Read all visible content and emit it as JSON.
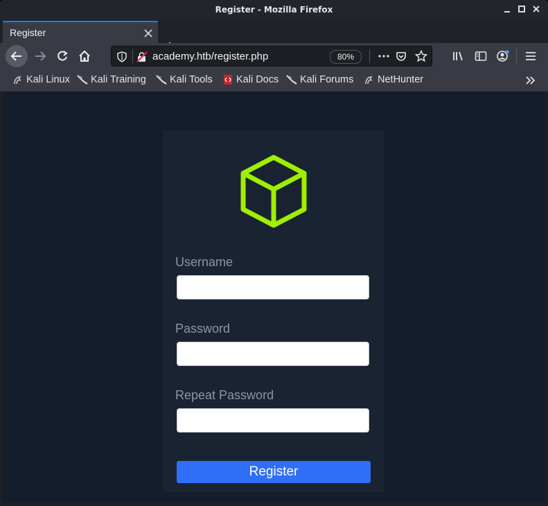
{
  "window": {
    "title": "Register - Mozilla Firefox"
  },
  "tabs": [
    {
      "label": "Register"
    }
  ],
  "navbar": {
    "url": "academy.htb/register.php",
    "zoom": "80%"
  },
  "bookmarks": [
    {
      "label": "Kali Linux",
      "icon": "kali-dragon-icon"
    },
    {
      "label": "Kali Training",
      "icon": "kali-knife-icon"
    },
    {
      "label": "Kali Tools",
      "icon": "kali-knife-icon"
    },
    {
      "label": "Kali Docs",
      "icon": "kali-docs-icon"
    },
    {
      "label": "Kali Forums",
      "icon": "kali-knife-icon"
    },
    {
      "label": "NetHunter",
      "icon": "kali-dragon-icon"
    }
  ],
  "form": {
    "username_label": "Username",
    "password_label": "Password",
    "repeat_label": "Repeat Password",
    "username_value": "",
    "password_value": "",
    "repeat_value": "",
    "submit_label": "Register"
  },
  "colors": {
    "page_bg": "#141d2b",
    "card_bg": "#1a2332",
    "logo": "#9fef00",
    "button": "#2f6ff5",
    "tab_accent": "#0a84ff"
  }
}
